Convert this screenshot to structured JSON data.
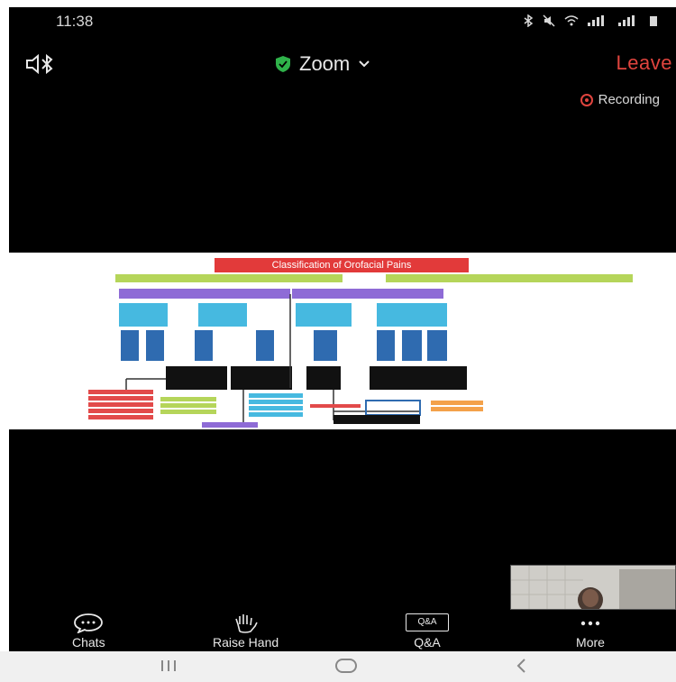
{
  "status_bar": {
    "time": "11:38"
  },
  "header": {
    "title": "Zoom",
    "leave_label": "Leave",
    "recording_label": "Recording"
  },
  "slide": {
    "title": "Classification of Orofacial Pains"
  },
  "toolbar": {
    "items": [
      {
        "label": "Chats"
      },
      {
        "label": "Raise Hand"
      },
      {
        "label": "Q&A",
        "icon_text": "Q&A"
      },
      {
        "label": "More"
      }
    ]
  },
  "colors": {
    "leave": "#e0443e",
    "shield": "#2fb24a",
    "background": "#000000"
  },
  "icons": [
    "speaker-bluetooth-icon",
    "shield-icon",
    "chevron-down-icon",
    "recording-icon",
    "chat-icon",
    "raise-hand-icon",
    "qa-icon",
    "more-icon"
  ]
}
